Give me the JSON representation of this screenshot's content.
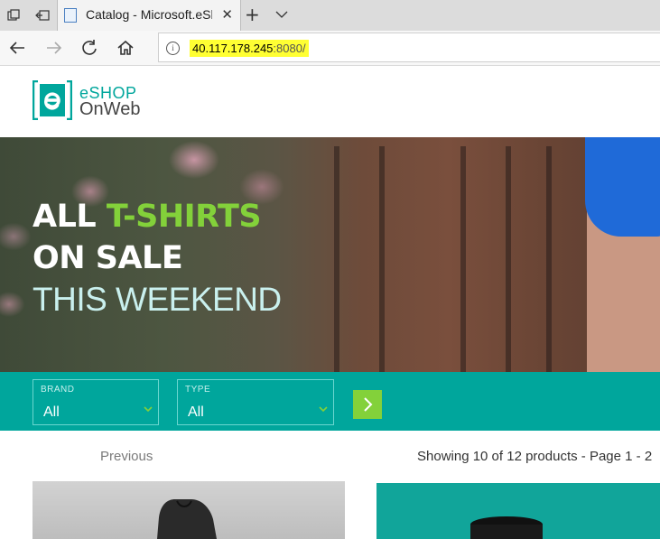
{
  "browser": {
    "tab": {
      "title": "Catalog - Microsoft.eSh"
    },
    "address": {
      "host": "40.117.178.245",
      "rest": ":8080/"
    }
  },
  "header": {
    "logo_line1": "eSHOP",
    "logo_line2": "OnWeb"
  },
  "hero": {
    "line1_part1": "ALL",
    "line1_part2": "T-SHIRTS",
    "line2": "ON SALE",
    "line3": "THIS WEEKEND"
  },
  "filters": {
    "brand": {
      "label": "BRAND",
      "value": "All"
    },
    "type": {
      "label": "TYPE",
      "value": "All"
    }
  },
  "pager": {
    "previous": "Previous",
    "info": "Showing 10 of 12 products - Page 1 - 2"
  },
  "colors": {
    "brand_teal": "#00a69c",
    "accent_green": "#83d13a",
    "url_highlight": "#ffff33"
  },
  "icons": [
    "tab-actions-icon",
    "set-aside-tabs-icon",
    "page-favicon",
    "close-icon",
    "plus-icon",
    "chevron-down-icon",
    "back-arrow-icon",
    "forward-arrow-icon",
    "refresh-icon",
    "home-icon",
    "info-icon",
    "chevron-right-icon"
  ]
}
